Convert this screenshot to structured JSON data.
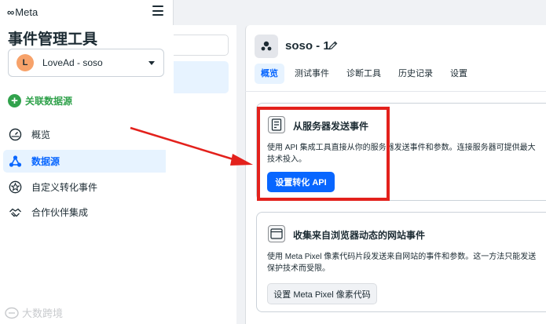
{
  "sidebar": {
    "brand": {
      "mark": "∞",
      "name": "Meta"
    },
    "title": "事件管理工具",
    "account": {
      "initial": "L",
      "name": "LoveAd - soso"
    },
    "connect_label": "关联数据源",
    "nav": [
      {
        "label": "概览",
        "icon": "dashboard-gauge-icon"
      },
      {
        "label": "数据源",
        "icon": "data-sources-icon"
      },
      {
        "label": "自定义转化事件",
        "icon": "star-badge-icon"
      },
      {
        "label": "合作伙伴集成",
        "icon": "handshake-icon"
      }
    ],
    "watermark": "大数跨境"
  },
  "datasource": {
    "name": "soso - 1",
    "tabs": [
      "概览",
      "测试事件",
      "诊断工具",
      "历史记录",
      "设置"
    ],
    "active_tab": "概览"
  },
  "cards": {
    "server": {
      "title": "从服务器发送事件",
      "desc_line1": "使用 API 集成工具直接从你的服务器发送事件和参数。连接服务器可提供最大",
      "desc_line2": "技术投入。",
      "button": "设置转化 API"
    },
    "browser": {
      "title": "收集来自浏览器动态的网站事件",
      "desc_line1": "使用 Meta Pixel 像素代码片段发送来自网站的事件和参数。这一方法只能发送",
      "desc_line2": "保护技术而受限。",
      "button": "设置 Meta Pixel 像素代码"
    }
  },
  "colors": {
    "primary": "#0866ff",
    "success": "#31a24c",
    "annotation_red": "#e3211c",
    "active_bg": "#e7f3ff"
  }
}
